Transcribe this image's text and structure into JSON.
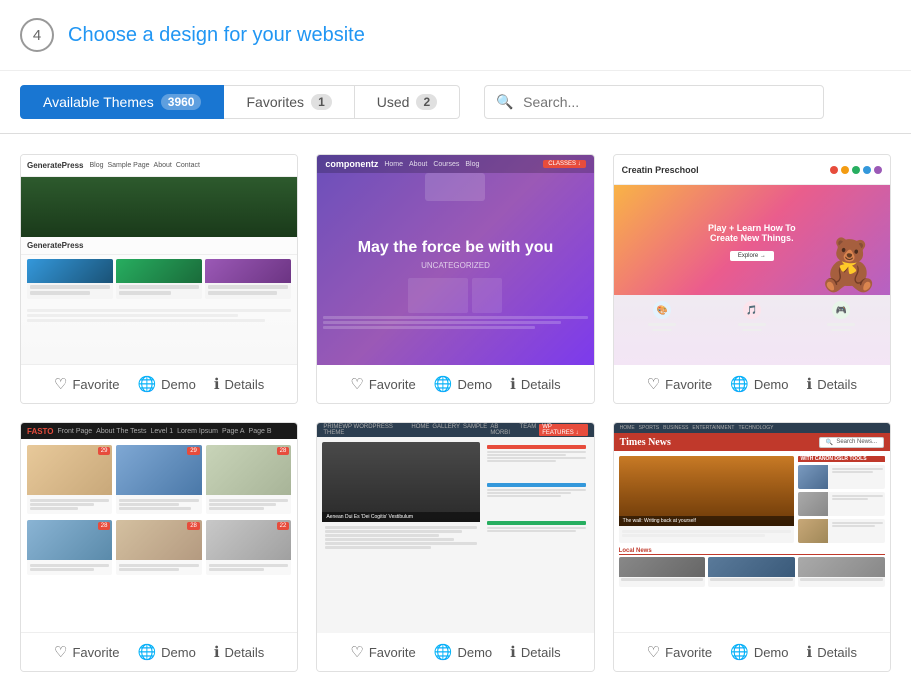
{
  "header": {
    "step_number": "4",
    "title_plain": "Choose a design for your",
    "title_highlight": "website"
  },
  "tabs": [
    {
      "id": "available",
      "label": "Available Themes",
      "badge": "3960",
      "active": true
    },
    {
      "id": "favorites",
      "label": "Favorites",
      "badge": "1",
      "active": false
    },
    {
      "id": "used",
      "label": "Used",
      "badge": "2",
      "active": false
    }
  ],
  "search": {
    "placeholder": "Search..."
  },
  "themes": [
    {
      "id": "generatepress",
      "name": "GeneratePress",
      "actions": {
        "favorite": "Favorite",
        "demo": "Demo",
        "details": "Details"
      }
    },
    {
      "id": "componentz",
      "name": "Componentz",
      "tagline": "May the force be with you",
      "actions": {
        "favorite": "Favorite",
        "demo": "Demo",
        "details": "Details"
      }
    },
    {
      "id": "creatin-preschool",
      "name": "Creatin Preschool",
      "actions": {
        "favorite": "Favorite",
        "demo": "Demo",
        "details": "Details"
      }
    },
    {
      "id": "fasto",
      "name": "FASTO",
      "actions": {
        "favorite": "Favorite",
        "demo": "Demo",
        "details": "Details"
      }
    },
    {
      "id": "primewp",
      "name": "PrimeWP WordPress Theme",
      "actions": {
        "favorite": "Favorite",
        "demo": "Demo",
        "details": "Details"
      }
    },
    {
      "id": "timesnews",
      "name": "Times News",
      "actions": {
        "favorite": "Favorite",
        "demo": "Demo",
        "details": "Details"
      }
    }
  ]
}
